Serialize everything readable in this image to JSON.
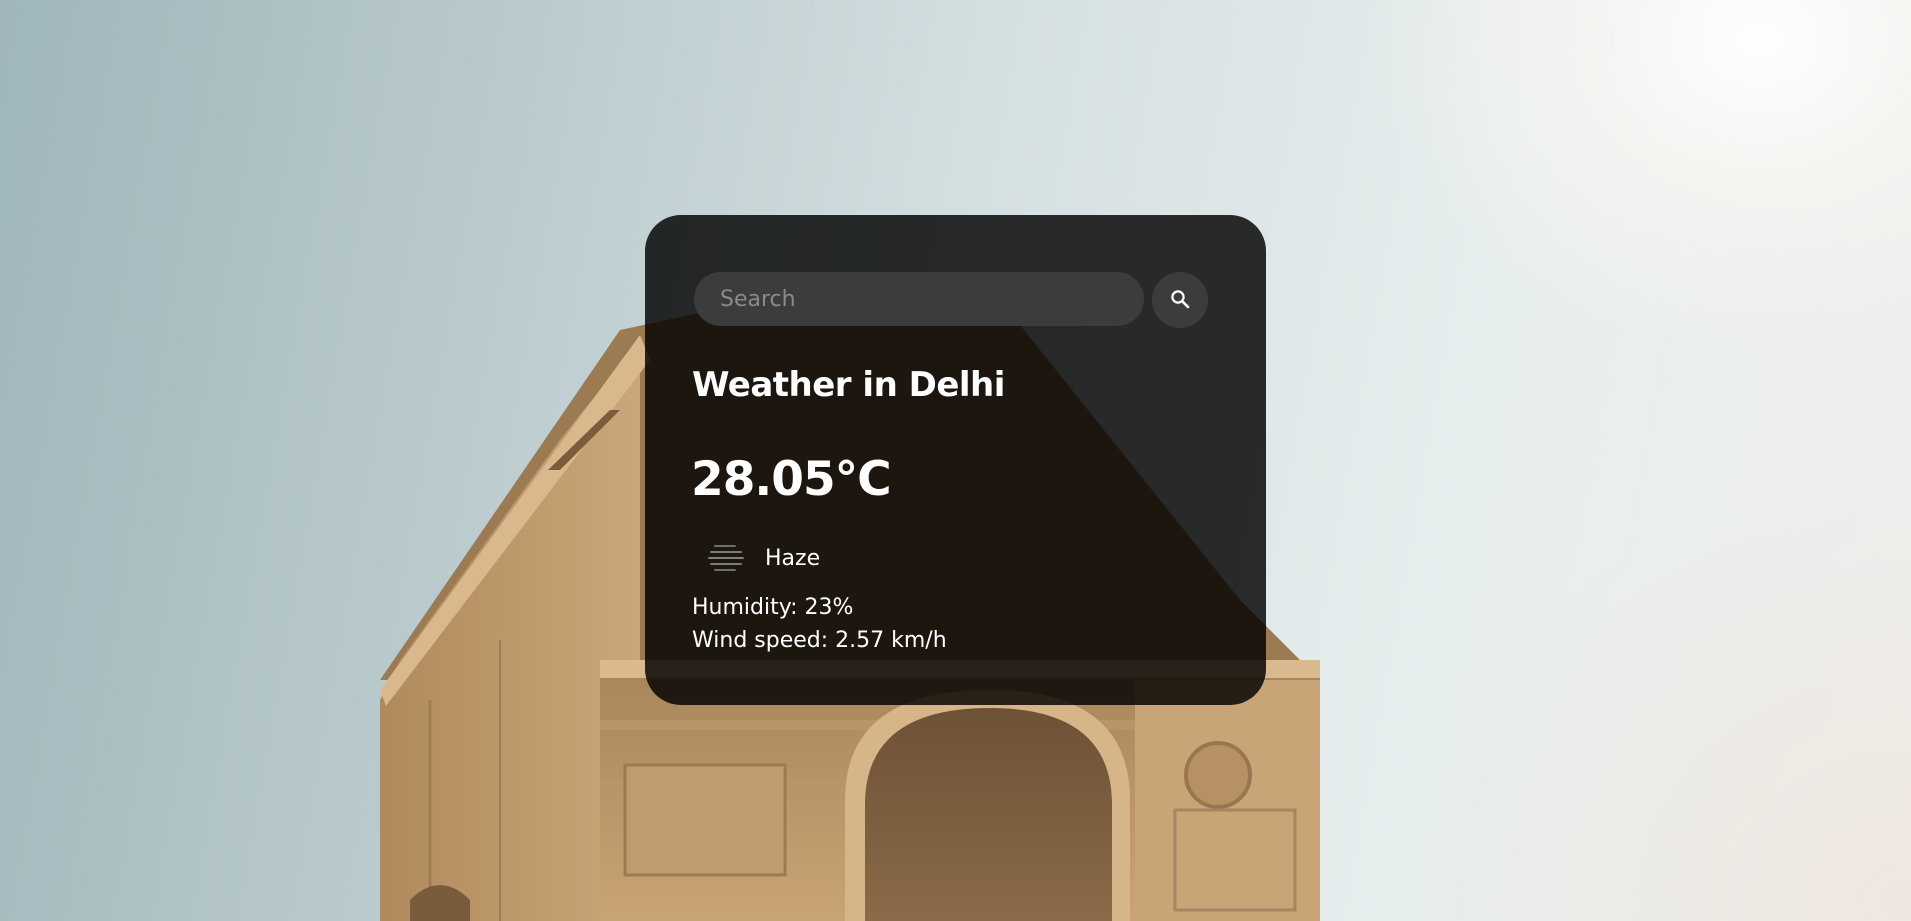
{
  "search": {
    "placeholder": "Search",
    "value": "",
    "button_icon": "search-icon"
  },
  "weather": {
    "title": "Weather in Delhi",
    "temperature": "28.05°C",
    "condition_icon": "haze-icon",
    "condition": "Haze",
    "humidity": "Humidity: 23%",
    "wind": "Wind speed: 2.57 km/h"
  },
  "background": {
    "subject": "india-gate-photo"
  },
  "colors": {
    "card_background": "#000000",
    "input_background": "#3c3c3c",
    "text": "#ffffff",
    "placeholder": "#8a8a8a"
  }
}
